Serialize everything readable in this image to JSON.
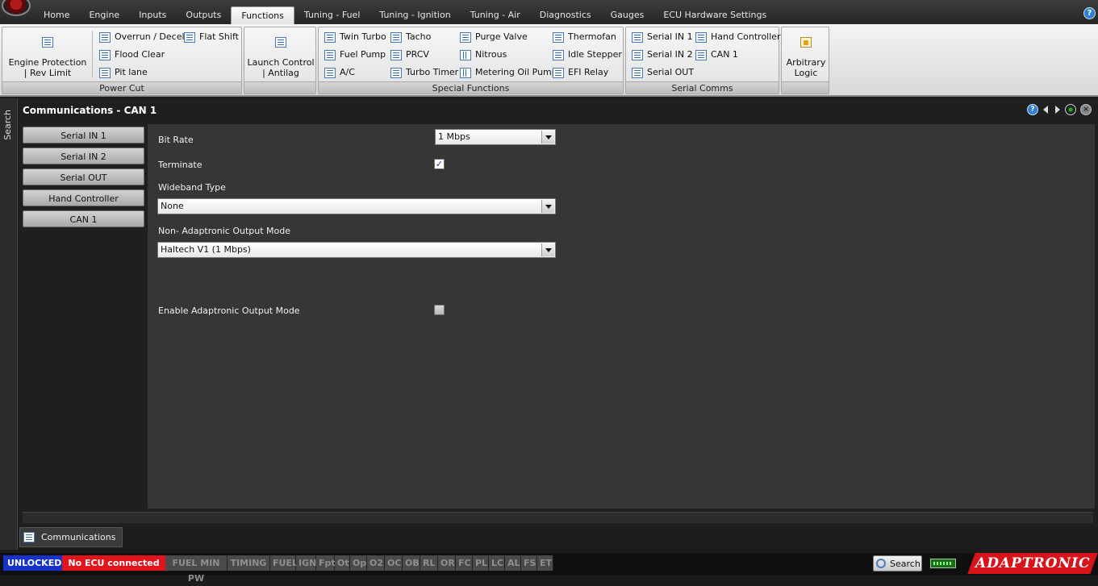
{
  "menu": {
    "tabs": [
      "Home",
      "Engine",
      "Inputs",
      "Outputs",
      "Functions",
      "Tuning - Fuel",
      "Tuning - Ignition",
      "Tuning - Air",
      "Diagnostics",
      "Gauges",
      "ECU Hardware Settings"
    ],
    "active": "Functions",
    "help_glyph": "?"
  },
  "ribbon": {
    "power_cut": {
      "label": "Power Cut",
      "engine_protection": "Engine Protection | Rev Limit",
      "overrun": "Overrun / Decel",
      "flat_shift": "Flat Shift",
      "flood_clear": "Flood Clear",
      "pit_lane": "Pit lane"
    },
    "launch": {
      "label": "Launch Control | Antilag"
    },
    "special": {
      "label": "Special Functions",
      "twin_turbo": "Twin Turbo",
      "tacho": "Tacho",
      "purge_valve": "Purge Valve",
      "thermofan": "Thermofan",
      "fuel_pump": "Fuel Pump",
      "prcv": "PRCV",
      "nitrous": "Nitrous",
      "idle_stepper": "Idle Stepper",
      "ac": "A/C",
      "turbo_timer": "Turbo Timer",
      "metering_oil_pump": "Metering Oil Pump",
      "efi_relay": "EFI Relay"
    },
    "serial": {
      "label": "Serial Comms",
      "serial_in_1": "Serial IN 1",
      "hand_controller": "Hand Controller",
      "serial_in_2": "Serial IN 2",
      "can_1": "CAN 1",
      "serial_out": "Serial OUT"
    },
    "logic": {
      "label": "Arbitrary Logic"
    }
  },
  "search_rail": "Search",
  "panel": {
    "title": "Communications - CAN 1",
    "help_glyph": "?",
    "close_glyph": "×",
    "side_buttons": [
      "Serial IN 1",
      "Serial IN 2",
      "Serial OUT",
      "Hand Controller",
      "CAN 1"
    ],
    "form": {
      "bit_rate_label": "Bit Rate",
      "bit_rate_value": "1 Mbps",
      "terminate_label": "Terminate",
      "terminate_checked": true,
      "terminate_mark": "✓",
      "wideband_label": "Wideband Type",
      "wideband_value": "None",
      "non_adaptronic_label": "Non- Adaptronic Output Mode",
      "non_adaptronic_value": "Haltech V1 (1 Mbps)",
      "enable_adaptronic_label": "Enable Adaptronic Output Mode",
      "enable_adaptronic_checked": false
    }
  },
  "doc_tab": "Communications",
  "status": {
    "lock": "UNLOCKED",
    "connection": "No ECU connected",
    "flags": [
      "FUEL MIN PW",
      "TIMING",
      "FUEL",
      "IGN",
      "Fpt",
      "Ot",
      "Op",
      "O2",
      "OC",
      "OB",
      "RL",
      "OR",
      "FC",
      "PL",
      "LC",
      "AL",
      "FS",
      "ET"
    ],
    "search": "Search",
    "brand": "ADAPTRONIC"
  },
  "colors": {
    "unlocked_bg": "#1632c8",
    "no_ecu_bg": "#e0141a",
    "brand_red": "#d8141b"
  }
}
